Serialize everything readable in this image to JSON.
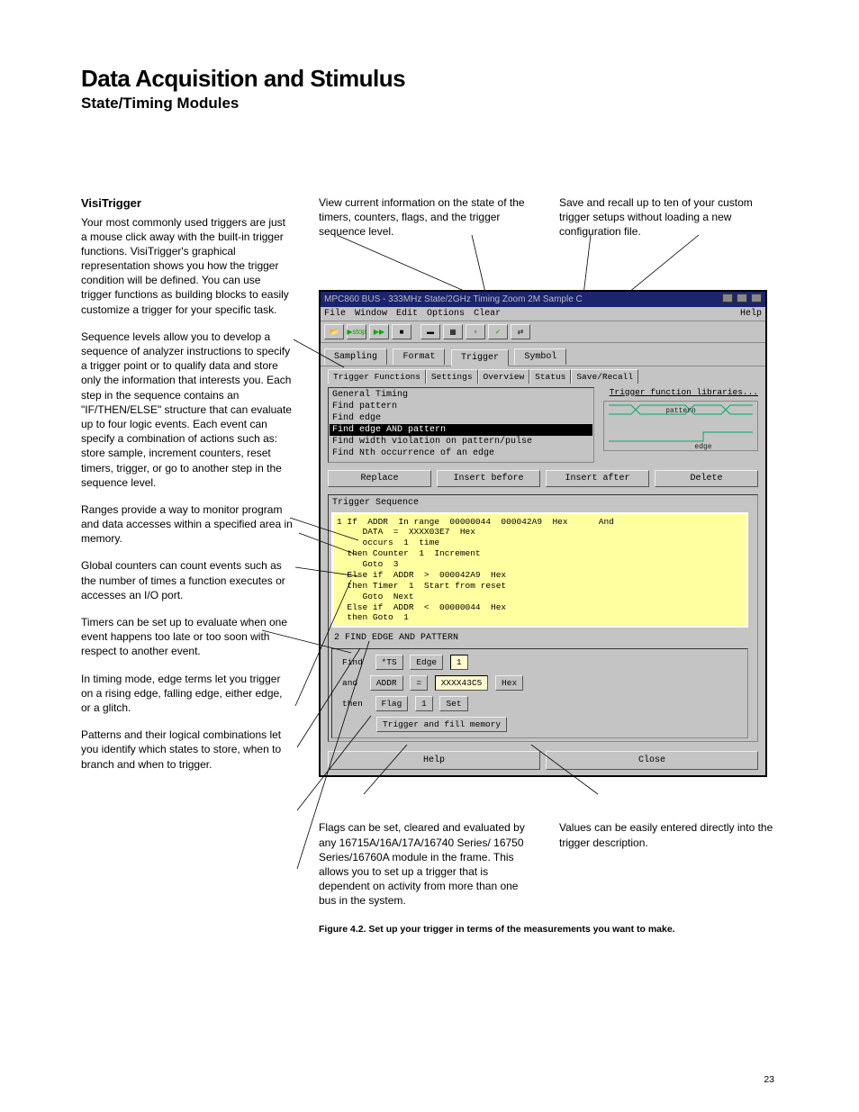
{
  "page_number": "23",
  "headings": {
    "main": "Data Acquisition and Stimulus",
    "sub": "State/Timing Modules"
  },
  "left_col": {
    "h3": "VisiTrigger",
    "p1": "Your most commonly used triggers are just a mouse click away with the built-in trigger functions. VisiTrigger's graphical representation shows you how the trigger condition will be defined. You can use trigger functions as building blocks to easily customize a trigger for your specific task.",
    "p2": "Sequence levels allow you to develop a sequence of analyzer instructions to specify a trigger point or to qualify data and store only the information that interests you. Each step in the sequence contains an \"IF/THEN/ELSE\" structure that can evaluate up to four logic events. Each event can specify a combination of actions such as: store sample, increment counters, reset timers, trigger, or go to another step in the sequence level.",
    "p3": "Ranges provide a way to monitor program and data accesses within a specified area in memory.",
    "p4": "Global counters can count events such as the number of times a function executes or accesses an I/O port.",
    "p5": "Timers can be set up to evaluate when one event happens too late or too soon with respect to another event.",
    "p6": "In timing mode, edge terms let you trigger on a rising edge, falling edge, either edge, or a glitch.",
    "p7": "Patterns and their logical combinations let you identify which states to store, when to branch and when to trigger."
  },
  "annot_top": {
    "a1": "View current information on the state of the timers, counters, flags, and the trigger sequence level.",
    "a2": "Save and recall up to ten of your custom trigger setups without loading a new configuration file."
  },
  "app": {
    "title": "MPC860 BUS - 333MHz State/2GHz Timing Zoom 2M Sample C",
    "menu": {
      "file": "File",
      "window": "Window",
      "edit": "Edit",
      "options": "Options",
      "clear": "Clear",
      "help": "Help"
    },
    "tabs": {
      "sampling": "Sampling",
      "format": "Format",
      "trigger": "Trigger",
      "symbol": "Symbol"
    },
    "subtabs": {
      "tf": "Trigger Functions",
      "settings": "Settings",
      "overview": "Overview",
      "status": "Status",
      "saverecall": "Save/Recall"
    },
    "funclist": {
      "i0": "General Timing",
      "i1": "Find pattern",
      "i2": "Find edge",
      "i3": "Find edge AND pattern",
      "i4": "Find width violation on pattern/pulse",
      "i5": "Find Nth occurrence of an edge"
    },
    "lib_link": "Trigger function libraries...",
    "wave": {
      "pattern": "pattern",
      "edge": "edge"
    },
    "btns": {
      "replace": "Replace",
      "ibefore": "Insert before",
      "iafter": "Insert after",
      "delete": "Delete"
    },
    "seq_head": "Trigger Sequence",
    "seq1": "1 If  ADDR  In range  00000044  000042A9  Hex      And\n     DATA  =  XXXX03E7  Hex\n     occurs  1  time\n  then Counter  1  Increment\n     Goto  3\n  Else if  ADDR  >  000042A9  Hex\n  then Timer  1  Start from reset\n     Goto  Next\n  Else if  ADDR  <  00000044  Hex\n  then Goto  1",
    "seq2_head": "2  FIND EDGE AND PATTERN",
    "seq2": {
      "find": "Find",
      "ts": "*TS",
      "edge": "Edge",
      "one": "1",
      "and": "and",
      "addr": "ADDR",
      "eq": "=",
      "val": "XXXX43C5",
      "hex": "Hex",
      "then": "then",
      "flag": "Flag",
      "set": "Set",
      "trig": "Trigger and fill memory"
    },
    "bottom": {
      "help": "Help",
      "close": "Close"
    }
  },
  "annot_bottom": {
    "b1": "Flags can be set, cleared and evaluated by any 16715A/16A/17A/16740 Series/ 16750 Series/16760A module in the frame. This allows you to set up a trigger that is dependent on activity from more than one bus in the system.",
    "b2": "Values can be easily entered directly into the trigger description."
  },
  "fig_caption": "Figure 4.2. Set up your trigger in terms of the measurements you want to make."
}
